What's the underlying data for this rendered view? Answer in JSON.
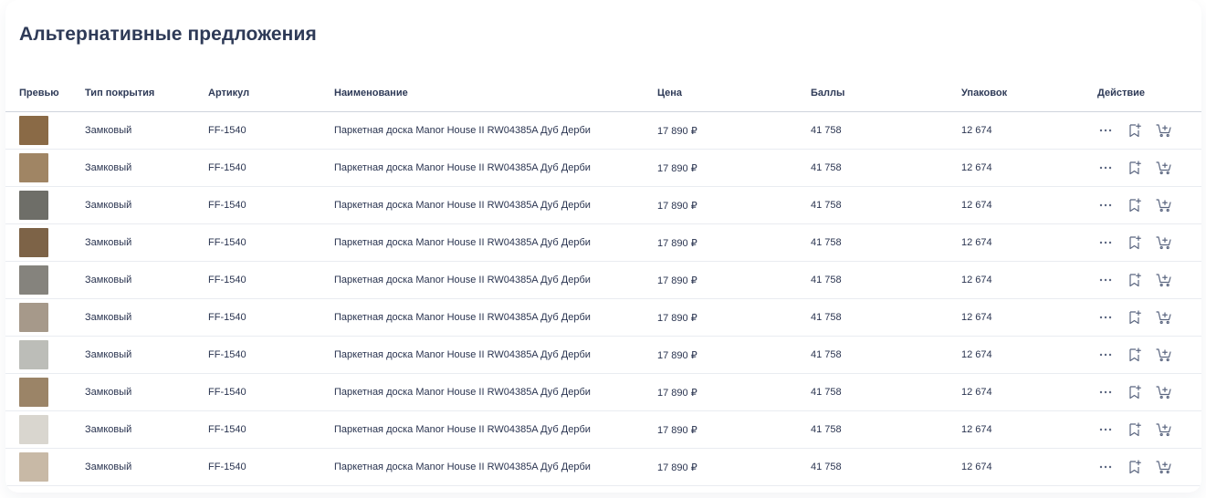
{
  "title": "Альтернативные предложения",
  "columns": {
    "preview": "Превью",
    "type": "Тип покрытия",
    "sku": "Артикул",
    "name": "Наименование",
    "price": "Цена",
    "points": "Баллы",
    "packs": "Упаковок",
    "action": "Действие"
  },
  "rows": [
    {
      "swatch": "#8a6a46",
      "type": "Замковый",
      "sku": "FF-1540",
      "name": "Паркетная доска Manor House II RW04385A Дуб Дерби",
      "price": "17 890 ₽",
      "points": "41 758",
      "packs": "12 674"
    },
    {
      "swatch": "#a08564",
      "type": "Замковый",
      "sku": "FF-1540",
      "name": "Паркетная доска Manor House II RW04385A Дуб Дерби",
      "price": "17 890 ₽",
      "points": "41 758",
      "packs": "12 674"
    },
    {
      "swatch": "#6e6e68",
      "type": "Замковый",
      "sku": "FF-1540",
      "name": "Паркетная доска Manor House II RW04385A Дуб Дерби",
      "price": "17 890 ₽",
      "points": "41 758",
      "packs": "12 674"
    },
    {
      "swatch": "#7d6347",
      "type": "Замковый",
      "sku": "FF-1540",
      "name": "Паркетная доска Manor House II RW04385A Дуб Дерби",
      "price": "17 890 ₽",
      "points": "41 758",
      "packs": "12 674"
    },
    {
      "swatch": "#85837d",
      "type": "Замковый",
      "sku": "FF-1540",
      "name": "Паркетная доска Manor House II RW04385A Дуб Дерби",
      "price": "17 890 ₽",
      "points": "41 758",
      "packs": "12 674"
    },
    {
      "swatch": "#a6998a",
      "type": "Замковый",
      "sku": "FF-1540",
      "name": "Паркетная доска Manor House II RW04385A Дуб Дерби",
      "price": "17 890 ₽",
      "points": "41 758",
      "packs": "12 674"
    },
    {
      "swatch": "#bcbdb8",
      "type": "Замковый",
      "sku": "FF-1540",
      "name": "Паркетная доска Manor House II RW04385A Дуб Дерби",
      "price": "17 890 ₽",
      "points": "41 758",
      "packs": "12 674"
    },
    {
      "swatch": "#9b8467",
      "type": "Замковый",
      "sku": "FF-1540",
      "name": "Паркетная доска Manor House II RW04385A Дуб Дерби",
      "price": "17 890 ₽",
      "points": "41 758",
      "packs": "12 674"
    },
    {
      "swatch": "#d9d6cf",
      "type": "Замковый",
      "sku": "FF-1540",
      "name": "Паркетная доска Manor House II RW04385A Дуб Дерби",
      "price": "17 890 ₽",
      "points": "41 758",
      "packs": "12 674"
    },
    {
      "swatch": "#c8b9a6",
      "type": "Замковый",
      "sku": "FF-1540",
      "name": "Паркетная доска Manor House II RW04385A Дуб Дерби",
      "price": "17 890 ₽",
      "points": "41 758",
      "packs": "12 674"
    }
  ],
  "icons": {
    "more": "more-dots-icon",
    "bookmark": "bookmark-add-icon",
    "cart": "cart-add-icon"
  },
  "colors": {
    "title": "#2e3a57",
    "text": "#2a3450",
    "icon": "#5b6680",
    "divider": "#e9ecf1"
  }
}
